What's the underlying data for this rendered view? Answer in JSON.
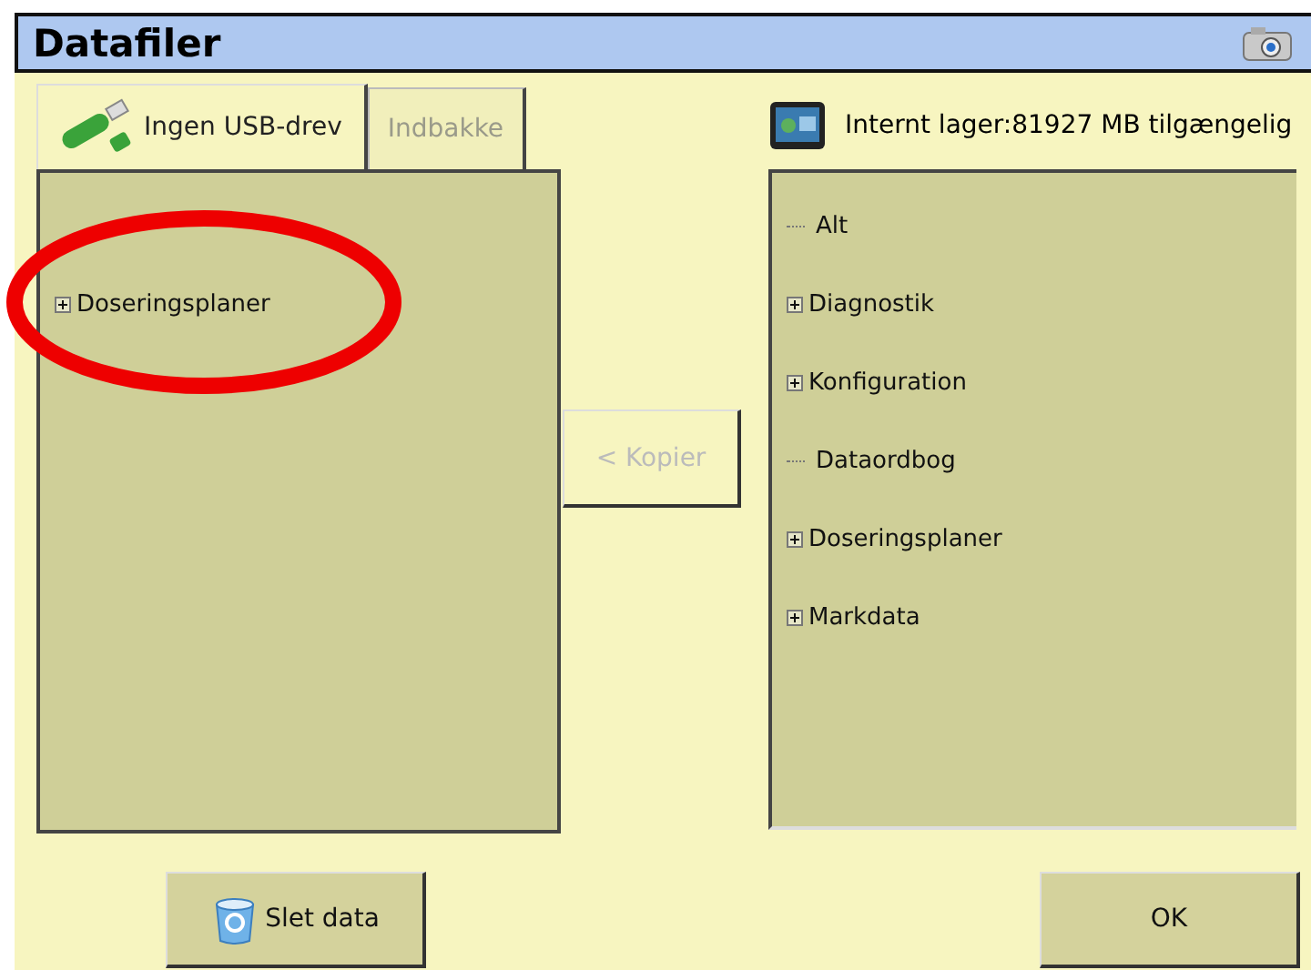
{
  "window": {
    "title": "Datafiler"
  },
  "tabs": [
    {
      "label": "Ingen USB-drev",
      "selected": true,
      "disabled": false
    },
    {
      "label": "Indbakke",
      "selected": false,
      "disabled": true
    }
  ],
  "left_tree": [
    {
      "label": "Doseringsplaner",
      "expandable": true
    }
  ],
  "copy_button": {
    "label": "< Kopier",
    "disabled": true
  },
  "storage": {
    "label": "Internt lager:81927 MB tilgængelig"
  },
  "right_tree": [
    {
      "label": "Alt",
      "expandable": false
    },
    {
      "label": "Diagnostik",
      "expandable": true
    },
    {
      "label": "Konfiguration",
      "expandable": true
    },
    {
      "label": "Dataordbog",
      "expandable": false
    },
    {
      "label": "Doseringsplaner",
      "expandable": true
    },
    {
      "label": "Markdata",
      "expandable": true
    }
  ],
  "buttons": [
    {
      "kind": "delete",
      "label": "Slet data"
    },
    {
      "kind": "ok",
      "label": "OK"
    }
  ]
}
